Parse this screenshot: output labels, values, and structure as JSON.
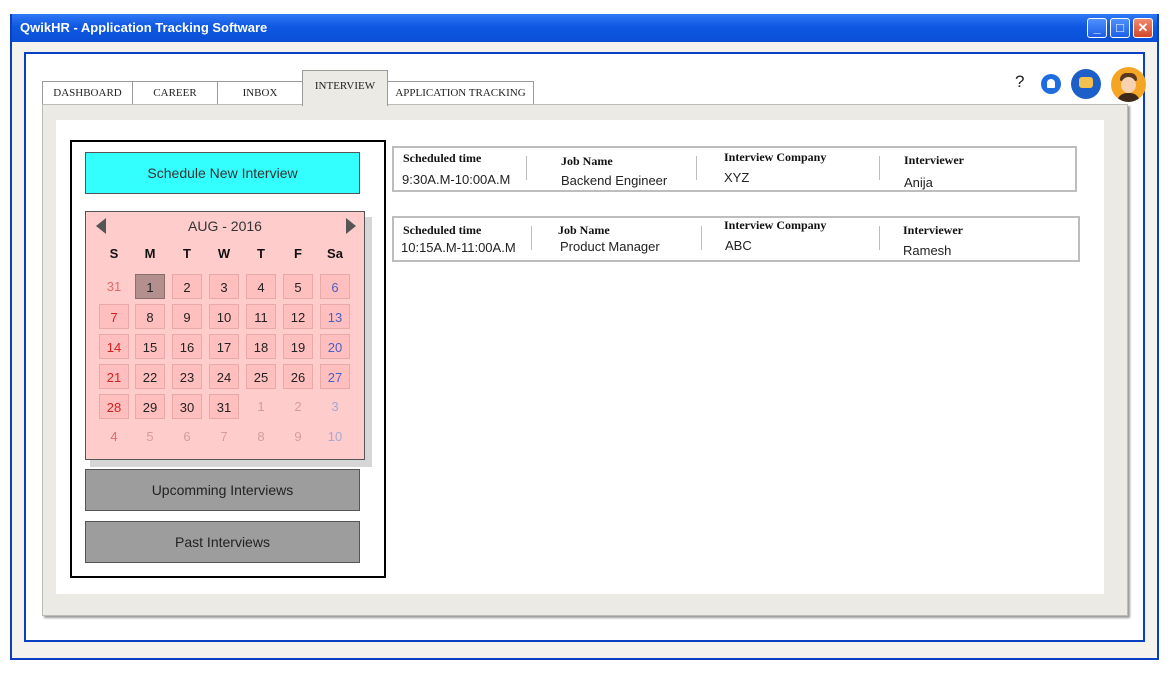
{
  "window": {
    "title": "QwikHR - Application Tracking Software",
    "minimize": "_",
    "maximize": "□",
    "close": "✕"
  },
  "tabs": [
    {
      "label": "DASHBOARD",
      "active": false
    },
    {
      "label": "CAREER",
      "active": false
    },
    {
      "label": "INBOX",
      "active": false
    },
    {
      "label": "INTERVIEW",
      "active": true
    },
    {
      "label": "APPLICATION TRACKING",
      "active": false
    }
  ],
  "header_icons": {
    "help": "?",
    "notifications": "bell-icon",
    "messages": "chat-icon",
    "profile": "avatar"
  },
  "sidebar": {
    "schedule_button": "Schedule New Interview",
    "upcoming_button": "Upcomming Interviews",
    "past_button": "Past Interviews"
  },
  "calendar": {
    "month_label": "AUG - 2016",
    "weekdays": [
      "S",
      "M",
      "T",
      "W",
      "T",
      "F",
      "Sa"
    ],
    "weeks": [
      [
        "31",
        "1",
        "2",
        "3",
        "4",
        "5",
        "6"
      ],
      [
        "7",
        "8",
        "9",
        "10",
        "11",
        "12",
        "13"
      ],
      [
        "14",
        "15",
        "16",
        "17",
        "18",
        "19",
        "20"
      ],
      [
        "21",
        "22",
        "23",
        "24",
        "25",
        "26",
        "27"
      ],
      [
        "28",
        "29",
        "30",
        "31",
        "1",
        "2",
        "3"
      ],
      [
        "4",
        "5",
        "6",
        "7",
        "8",
        "9",
        "10"
      ]
    ],
    "selected_day": "1"
  },
  "interviews": {
    "labels": {
      "time": "Scheduled time",
      "job": "Job Name",
      "company": "Interview Company",
      "interviewer": "Interviewer"
    },
    "rows": [
      {
        "time": "9:30A.M-10:00A.M",
        "job": "Backend Engineer",
        "company": "XYZ",
        "interviewer": "Anija"
      },
      {
        "time": "10:15A.M-11:00A.M",
        "job": "Product Manager",
        "company": "ABC",
        "interviewer": "Ramesh"
      }
    ]
  },
  "colors": {
    "titlebar": "#0f58e2",
    "schedule_button": "#33ffff",
    "calendar_bg": "#ffcccc",
    "sunday": "#d42020",
    "saturday": "#4a5fc0"
  }
}
